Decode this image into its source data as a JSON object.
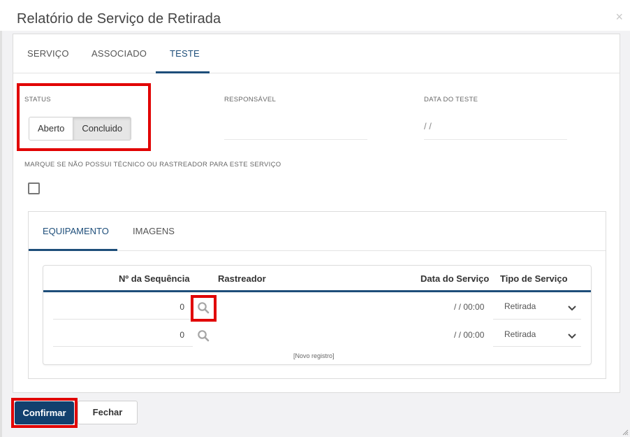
{
  "window": {
    "title": "Relatório de Serviço de Retirada",
    "close_glyph": "×"
  },
  "tabs": [
    {
      "label": "SERVIÇO",
      "active": false
    },
    {
      "label": "ASSOCIADO",
      "active": false
    },
    {
      "label": "TESTE",
      "active": true
    }
  ],
  "status": {
    "label": "STATUS",
    "options": [
      "Aberto",
      "Concluido"
    ],
    "selected": "Concluido"
  },
  "responsavel": {
    "label": "RESPONSÁVEL",
    "value": ""
  },
  "data_teste": {
    "label": "DATA DO TESTE",
    "value": "/ /"
  },
  "no_tech": {
    "label": "MARQUE SE NÃO POSSUI TÉCNICO OU RASTREADOR PARA ESTE SERVIÇO",
    "checked": false
  },
  "inner_tabs": [
    {
      "label": "EQUIPAMENTO",
      "active": true
    },
    {
      "label": "IMAGENS",
      "active": false
    }
  ],
  "grid": {
    "columns": [
      "Nº da Sequência",
      "Rastreador",
      "Data do Serviço",
      "Tipo de Serviço"
    ],
    "rows": [
      {
        "sequencia": "0",
        "rastreador": "",
        "data": "/ / 00:00",
        "tipo": "Retirada"
      },
      {
        "sequencia": "0",
        "rastreador": "",
        "data": "/ / 00:00",
        "tipo": "Retirada"
      }
    ],
    "new_record": "[Novo registro]"
  },
  "footer": {
    "confirm_label": "Confirmar",
    "close_label": "Fechar"
  },
  "colors": {
    "accent": "#1e4e7a",
    "confirm_bg": "#12406e",
    "highlight": "#e10000"
  },
  "icons": {
    "close": "close-icon",
    "search": "search-icon",
    "chevron": "chevron-down-icon",
    "resize": "resize-grip-icon"
  }
}
